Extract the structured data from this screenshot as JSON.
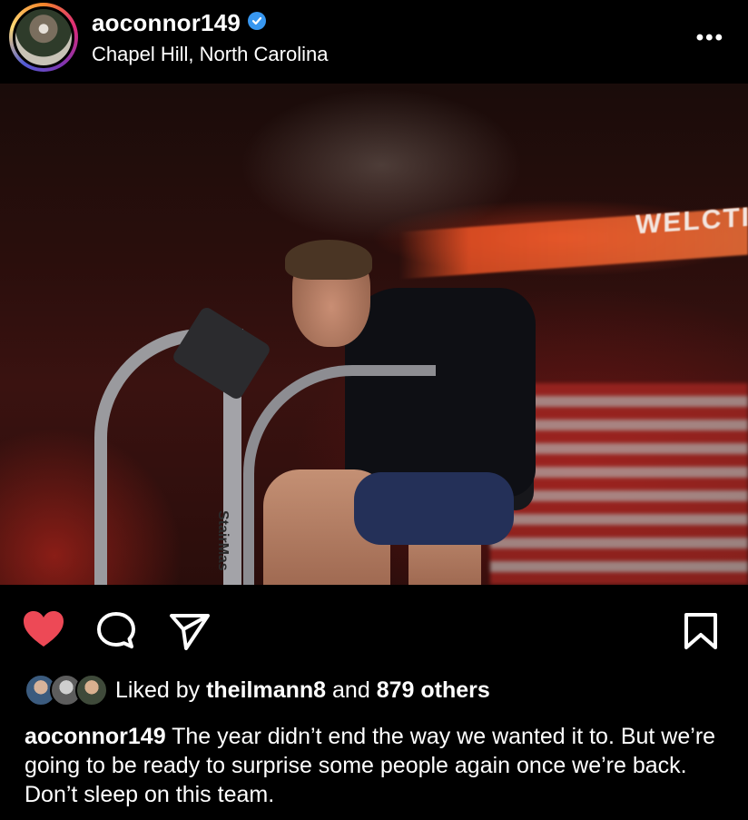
{
  "post": {
    "username": "aoconnor149",
    "location": "Chapel Hill, North Carolina",
    "more_label": "•••"
  },
  "photo": {
    "banner_text": "WELCTI",
    "equipment_label": "StairMas"
  },
  "actions": {
    "like_icon": "heart-icon",
    "comment_icon": "comment-icon",
    "share_icon": "send-icon",
    "save_icon": "bookmark-icon",
    "liked": true,
    "like_color": "#ed4956"
  },
  "likes": {
    "prefix": "Liked by",
    "user": "theilmann8",
    "joiner": "and",
    "others": "879 others"
  },
  "caption": {
    "username": "aoconnor149",
    "text": "The year didn’t end the way we wanted it to. But we’re going to be ready to surprise some people again once we’re back. Don’t sleep on this team."
  },
  "colors": {
    "background": "#000000",
    "text": "#ffffff",
    "verified": "#3897f0"
  }
}
